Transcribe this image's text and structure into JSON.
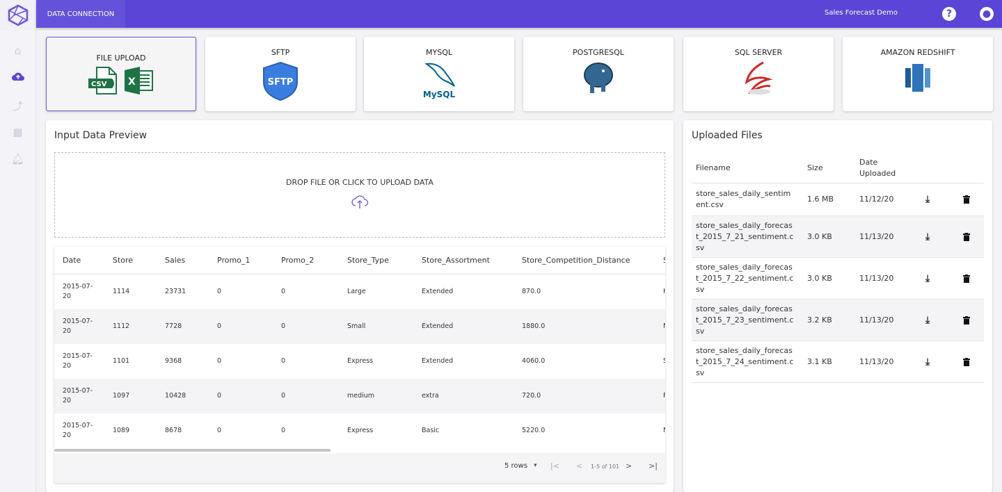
{
  "header": {
    "tab": "DATA CONNECTION",
    "project": "Sales Forecast Demo",
    "help_icon": "help-circle-icon",
    "account_icon": "account-circle-icon"
  },
  "sidebar": {
    "items": [
      {
        "name": "home",
        "icon": "home-icon"
      },
      {
        "name": "upload",
        "icon": "cloud-upload-icon",
        "active": true
      },
      {
        "name": "forecast",
        "icon": "trending-up-icon"
      },
      {
        "name": "dashboard",
        "icon": "dashboard-icon"
      },
      {
        "name": "notifications",
        "icon": "bell-icon"
      }
    ]
  },
  "sources": [
    {
      "label": "FILE UPLOAD",
      "selected": true
    },
    {
      "label": "SFTP",
      "logo_text": "SFTP"
    },
    {
      "label": "MYSQL",
      "logo_text": "MySQL"
    },
    {
      "label": "POSTGRESQL"
    },
    {
      "label": "SQL SERVER"
    },
    {
      "label": "AMAZON REDSHIFT"
    }
  ],
  "preview": {
    "title": "Input Data Preview",
    "drop_text": "DROP FILE OR CLICK TO UPLOAD DATA",
    "columns": [
      "Date",
      "Store",
      "Sales",
      "Promo_1",
      "Promo_2",
      "Store_Type",
      "Store_Assortment",
      "Store_Competition_Distance",
      "S"
    ],
    "rows": [
      [
        "2015-07-20",
        "1114",
        "23731",
        "0",
        "0",
        "Large",
        "Extended",
        "870.0",
        "H"
      ],
      [
        "2015-07-20",
        "1112",
        "7728",
        "0",
        "0",
        "Small",
        "Extended",
        "1880.0",
        "N"
      ],
      [
        "2015-07-20",
        "1101",
        "9368",
        "0",
        "0",
        "Express",
        "Extended",
        "4060.0",
        "S"
      ],
      [
        "2015-07-20",
        "1097",
        "10428",
        "0",
        "0",
        "medium",
        "extra",
        "720.0",
        "F"
      ],
      [
        "2015-07-20",
        "1089",
        "8678",
        "0",
        "0",
        "Express",
        "Basic",
        "5220.0",
        "N"
      ]
    ],
    "rows_per_page": "5 rows",
    "page_info": "1-5 of 101"
  },
  "uploaded": {
    "title": "Uploaded Files",
    "columns": [
      "Filename",
      "Size",
      "Date Uploaded"
    ],
    "files": [
      {
        "name": "store_sales_daily_sentiment.csv",
        "size": "1.6 MB",
        "date": "11/12/20"
      },
      {
        "name": "store_sales_daily_forecast_2015_7_21_sentiment.csv",
        "size": "3.0 KB",
        "date": "11/13/20"
      },
      {
        "name": "store_sales_daily_forecast_2015_7_22_sentiment.csv",
        "size": "3.0 KB",
        "date": "11/13/20"
      },
      {
        "name": "store_sales_daily_forecast_2015_7_23_sentiment.csv",
        "size": "3.2 KB",
        "date": "11/13/20"
      },
      {
        "name": "store_sales_daily_forecast_2015_7_24_sentiment.csv",
        "size": "3.1 KB",
        "date": "11/13/20"
      }
    ]
  },
  "colors": {
    "brand": "#5b45d6",
    "excel": "#1f7244"
  }
}
